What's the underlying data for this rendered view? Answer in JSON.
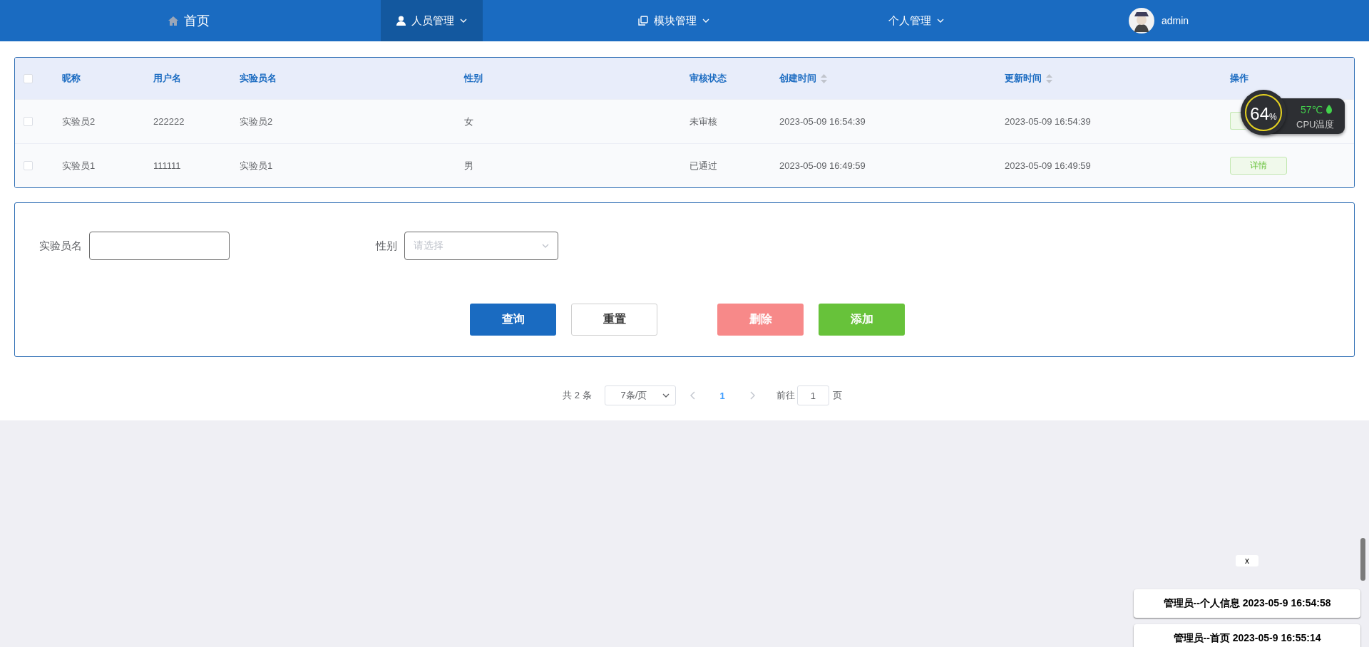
{
  "nav": {
    "items": [
      {
        "label": "首页",
        "kind": "home",
        "dropdown": false,
        "selected": false
      },
      {
        "label": "人员管理",
        "kind": "people",
        "dropdown": true,
        "selected": true
      },
      {
        "label": "模块管理",
        "kind": "modules",
        "dropdown": true,
        "selected": false
      },
      {
        "label": "个人管理",
        "kind": "personal",
        "dropdown": true,
        "selected": false
      }
    ],
    "user": {
      "name": "admin"
    }
  },
  "table": {
    "all_checked": false,
    "columns": [
      {
        "label": "昵称",
        "sortable": false
      },
      {
        "label": "用户名",
        "sortable": false
      },
      {
        "label": "实验员名",
        "sortable": false
      },
      {
        "label": "性别",
        "sortable": false
      },
      {
        "label": "审核状态",
        "sortable": false
      },
      {
        "label": "创建时间",
        "sortable": true
      },
      {
        "label": "更新时间",
        "sortable": true
      },
      {
        "label": "操作",
        "sortable": false
      }
    ],
    "rows": [
      {
        "checked": false,
        "cells": [
          "实验员2",
          "222222",
          "实验员2",
          "女",
          "未审核",
          "2023-05-09 16:54:39",
          "2023-05-09 16:54:39"
        ]
      },
      {
        "checked": false,
        "cells": [
          "实验员1",
          "111111",
          "实验员1",
          "男",
          "已通过",
          "2023-05-09 16:49:59",
          "2023-05-09 16:49:59"
        ],
        "action": "详情"
      }
    ]
  },
  "form": {
    "fields": [
      {
        "kind": "input",
        "label": "实验员名"
      },
      {
        "kind": "select",
        "label": "性别",
        "placeholder": "请选择"
      }
    ],
    "buttons": [
      {
        "label": "查询",
        "kind": "primary"
      },
      {
        "label": "重置",
        "kind": "plain"
      },
      {
        "label": "删除",
        "kind": "danger"
      },
      {
        "label": "添加",
        "kind": "success"
      }
    ]
  },
  "pagination": {
    "total": "共 2 条",
    "page_size": "7条/页",
    "pages": [
      {
        "label": "1",
        "selected": true
      }
    ],
    "goto_label": "前往",
    "goto_value": "1",
    "goto_suffix": "页"
  },
  "cpu_widget": {
    "usage": "64",
    "unit": "%",
    "temperature": "57℃",
    "label": "CPU温度"
  },
  "notifications": {
    "close": "x",
    "items": [
      "管理员--个人信息 2023-05-9 16:54:58",
      "管理员--首页 2023-05-9 16:55:14"
    ]
  }
}
